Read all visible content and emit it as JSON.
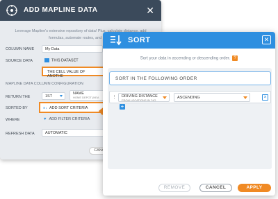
{
  "bg_dialog": {
    "title": "ADD MAPLINE DATA",
    "close": "✕",
    "description": "Leverage Mapline's extensive repository of data! Plus, calculate distance, add formulas, automate routes, and more!",
    "labels": {
      "column_name": "COLUMN NAME",
      "source_data": "SOURCE DATA",
      "section": "MAPLINE DATA COLUMN CONFIGURATION",
      "return_the": "RETURN THE",
      "sorted_by": "SORTED BY",
      "where": "WHERE",
      "refresh_data": "REFRESH DATA"
    },
    "values": {
      "column_name": "My Data",
      "source_data": "THIS DATASET",
      "cell_value": "THE CELL VALUE OF ANOTHE",
      "return_n": "1ST",
      "return_name": "NAME",
      "return_sub": "HOME DEPOT (NEA",
      "add_sort": "ADD SORT CRITERIA",
      "add_filter": "ADD FILTER CRITERIA",
      "refresh": "AUTOMATIC",
      "cancel": "CANC"
    }
  },
  "sort_dialog": {
    "title": "SORT",
    "close": "✕",
    "description": "Sort your data in ascending or descending order.",
    "help": "?",
    "order_label": "SORT IN THE FOLLOWING ORDER",
    "row": {
      "field": "DRIVING DISTANCE",
      "field_sub": "FROM LOCATIONS IN \"HO",
      "direction": "ASCENDING"
    },
    "add": "+",
    "buttons": {
      "remove": "REMOVE",
      "cancel": "CANCEL",
      "apply": "APPLY"
    }
  },
  "colors": {
    "primary": "#2e8fe0",
    "accent": "#f08a24",
    "dark_header": "#3b4a5b"
  }
}
